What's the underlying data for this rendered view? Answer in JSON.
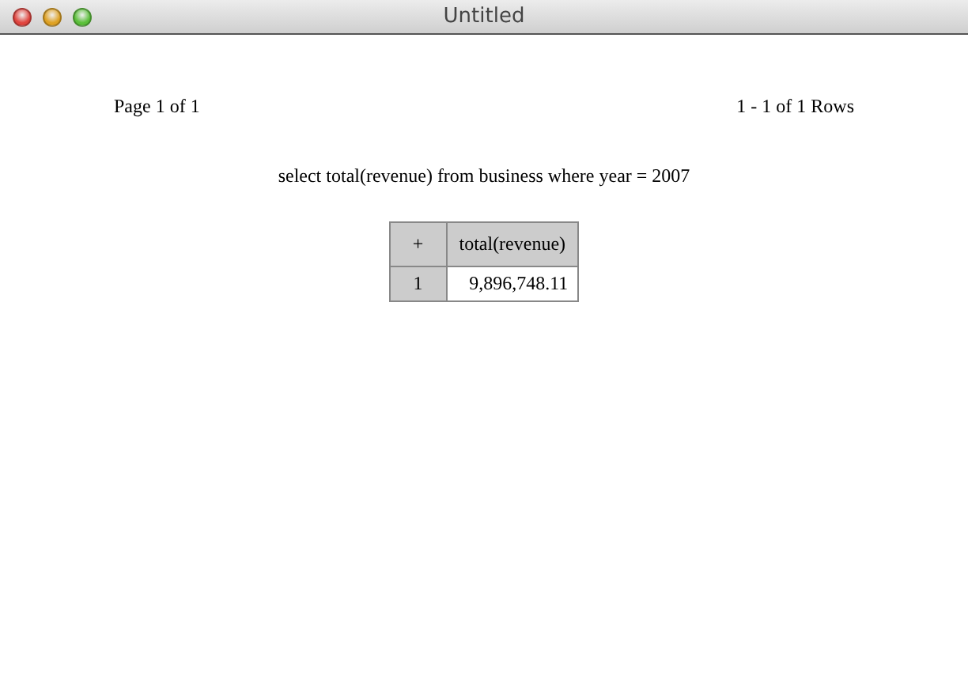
{
  "window": {
    "title": "Untitled"
  },
  "pager": {
    "page": "Page 1 of 1",
    "rows": "1 - 1 of 1 Rows"
  },
  "query": "select total(revenue) from business where year = 2007",
  "table": {
    "corner": "+",
    "columns": [
      "total(revenue)"
    ],
    "rows": [
      {
        "index": "1",
        "cells": [
          "9,896,748.11"
        ]
      }
    ]
  }
}
